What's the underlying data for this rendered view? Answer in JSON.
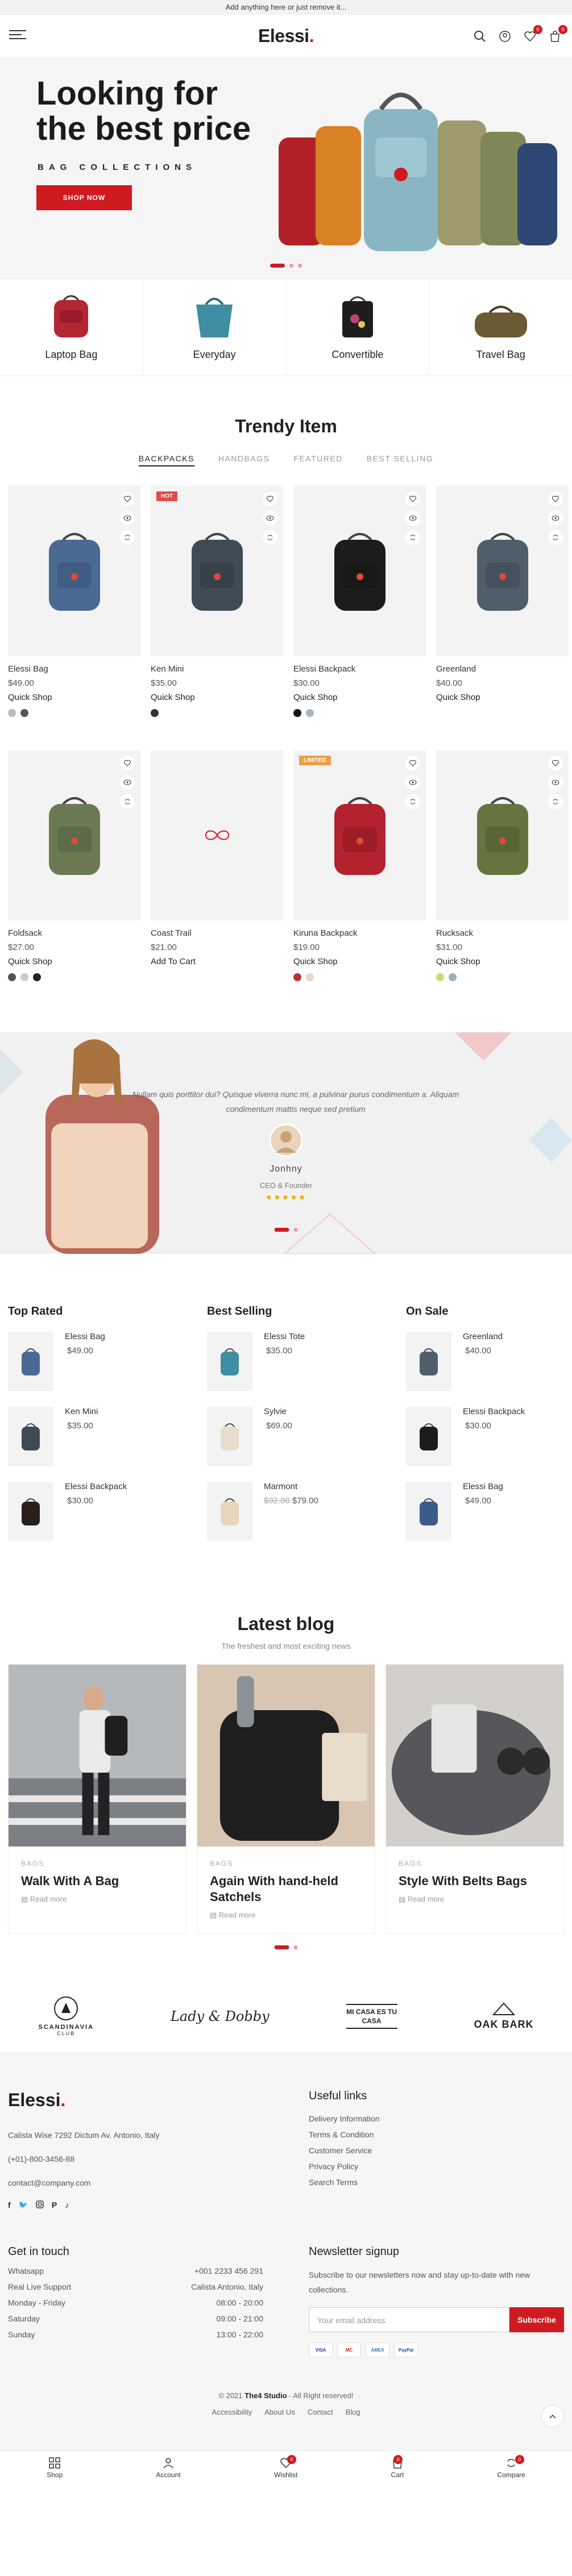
{
  "topbar": {
    "text": "Add anything here or just remove it..."
  },
  "header": {
    "logo": "Elessi",
    "logo_dot": ".",
    "wishlist_count": "0",
    "cart_count": "0"
  },
  "hero": {
    "title": "Looking for the best price",
    "subtitle": "BAG COLLECTIONS",
    "button": "SHOP NOW"
  },
  "categories": [
    {
      "label": "Laptop Bag"
    },
    {
      "label": "Everyday"
    },
    {
      "label": "Convertible"
    },
    {
      "label": "Travel Bag"
    }
  ],
  "trendy": {
    "title": "Trendy Item",
    "tabs": [
      "BACKPACKS",
      "HANDBAGS",
      "FEATURED",
      "BEST SELLING"
    ],
    "products": [
      {
        "name": "Elessi Bag",
        "price": "$49.00",
        "action": "Quick Shop",
        "tag": "",
        "color": "#4a6a94"
      },
      {
        "name": "Ken Mini",
        "price": "$35.00",
        "action": "Quick Shop",
        "tag": "HOT",
        "color": "#3f4a55"
      },
      {
        "name": "Elessi Backpack",
        "price": "$30.00",
        "action": "Quick Shop",
        "tag": "",
        "color": "#1c1c1c"
      },
      {
        "name": "Greenland",
        "price": "$40.00",
        "action": "Quick Shop",
        "tag": "",
        "color": "#505d6a"
      },
      {
        "name": "Foldsack",
        "price": "$27.00",
        "action": "Quick Shop",
        "tag": "",
        "color": "#6b7a52"
      },
      {
        "name": "Coast Trail",
        "price": "$21.00",
        "action": "Add To Cart",
        "tag": "",
        "color": ""
      },
      {
        "name": "Kiruna Backpack",
        "price": "$19.00",
        "action": "Quick Shop",
        "tag": "LIMITED",
        "color": "#b3222d"
      },
      {
        "name": "Rucksack",
        "price": "$31.00",
        "action": "Quick Shop",
        "tag": "",
        "color": "#66743f"
      }
    ]
  },
  "testimonial": {
    "quote": "Nullam quis porttitor dui? Quisque viverra nunc mi, a pulvinar purus condimentum a. Aliquam condimentum mattis neque sed pretium",
    "name": "Jonhny",
    "role": "CEO & Founder",
    "stars": "★★★★★"
  },
  "lists": [
    {
      "title": "Top Rated",
      "items": [
        {
          "name": "Elessi Bag",
          "price": "$49.00",
          "old": ""
        },
        {
          "name": "Ken Mini",
          "price": "$35.00",
          "old": ""
        },
        {
          "name": "Elessi Backpack",
          "price": "$30.00",
          "old": ""
        }
      ]
    },
    {
      "title": "Best Selling",
      "items": [
        {
          "name": "Elessi Tote",
          "price": "$35.00",
          "old": ""
        },
        {
          "name": "Sylvie",
          "price": "$69.00",
          "old": ""
        },
        {
          "name": "Marmont",
          "price": "$79.00",
          "old": "$92.00"
        }
      ]
    },
    {
      "title": "On Sale",
      "items": [
        {
          "name": "Greenland",
          "price": "$40.00",
          "old": ""
        },
        {
          "name": "Elessi Backpack",
          "price": "$30.00",
          "old": ""
        },
        {
          "name": "Elessi Bag",
          "price": "$49.00",
          "old": ""
        }
      ]
    }
  ],
  "blog": {
    "title": "Latest blog",
    "subtitle": "The freshest and most exciting news",
    "posts": [
      {
        "category": "BAGS",
        "title": "Walk With A Bag",
        "more": "Read more"
      },
      {
        "category": "BAGS",
        "title": "Again With hand-held Satchels",
        "more": "Read more"
      },
      {
        "category": "BAGS",
        "title": "Style With Belts Bags",
        "more": "Read more"
      }
    ]
  },
  "brands": [
    "SCANDINAVIA",
    "CLUB",
    "Lady & Dobby",
    "MI CASA ES TU CASA",
    "OAK BARK"
  ],
  "footer": {
    "logo": "Elessi",
    "address": "Calista Wise 7292 Dictum Av. Antonio, Italy",
    "phone": "(+01)-800-3456-88",
    "email": "contact@company.com",
    "useful_title": "Useful links",
    "useful_links": [
      "Delivery Information",
      "Terms & Condition",
      "Customer Service",
      "Privacy Policy",
      "Search Terms"
    ],
    "touch_title": "Get in touch",
    "touch_rows": [
      {
        "k": "Whatsapp",
        "v": "+001 2233 456 291"
      },
      {
        "k": "Real Live Support",
        "v": "Calista Antonio, Italy"
      },
      {
        "k": "Monday - Friday",
        "v": "08:00 - 20:00"
      },
      {
        "k": "Saturday",
        "v": "09:00 - 21:00"
      },
      {
        "k": "Sunday",
        "v": "13:00 - 22:00"
      }
    ],
    "newsletter_title": "Newsletter signup",
    "newsletter_text": "Subscribe to our newsletters now and stay up-to-date with new collections.",
    "newsletter_placeholder": "Your email address",
    "newsletter_button": "Subscribe",
    "pays": [
      "VISA",
      "MC",
      "AMEX",
      "PayPal"
    ],
    "copyright_pre": "© 2021 ",
    "copyright_brand": "The4 Studio",
    "copyright_post": " - All Right reserved!",
    "bottom_links": [
      "Accessibility",
      "About Us",
      "Contact",
      "Blog"
    ]
  },
  "bottom_nav": [
    {
      "label": "Shop",
      "badge": ""
    },
    {
      "label": "Account",
      "badge": ""
    },
    {
      "label": "Wishlist",
      "badge": "0"
    },
    {
      "label": "Cart",
      "badge": "0"
    },
    {
      "label": "Compare",
      "badge": "0"
    }
  ]
}
